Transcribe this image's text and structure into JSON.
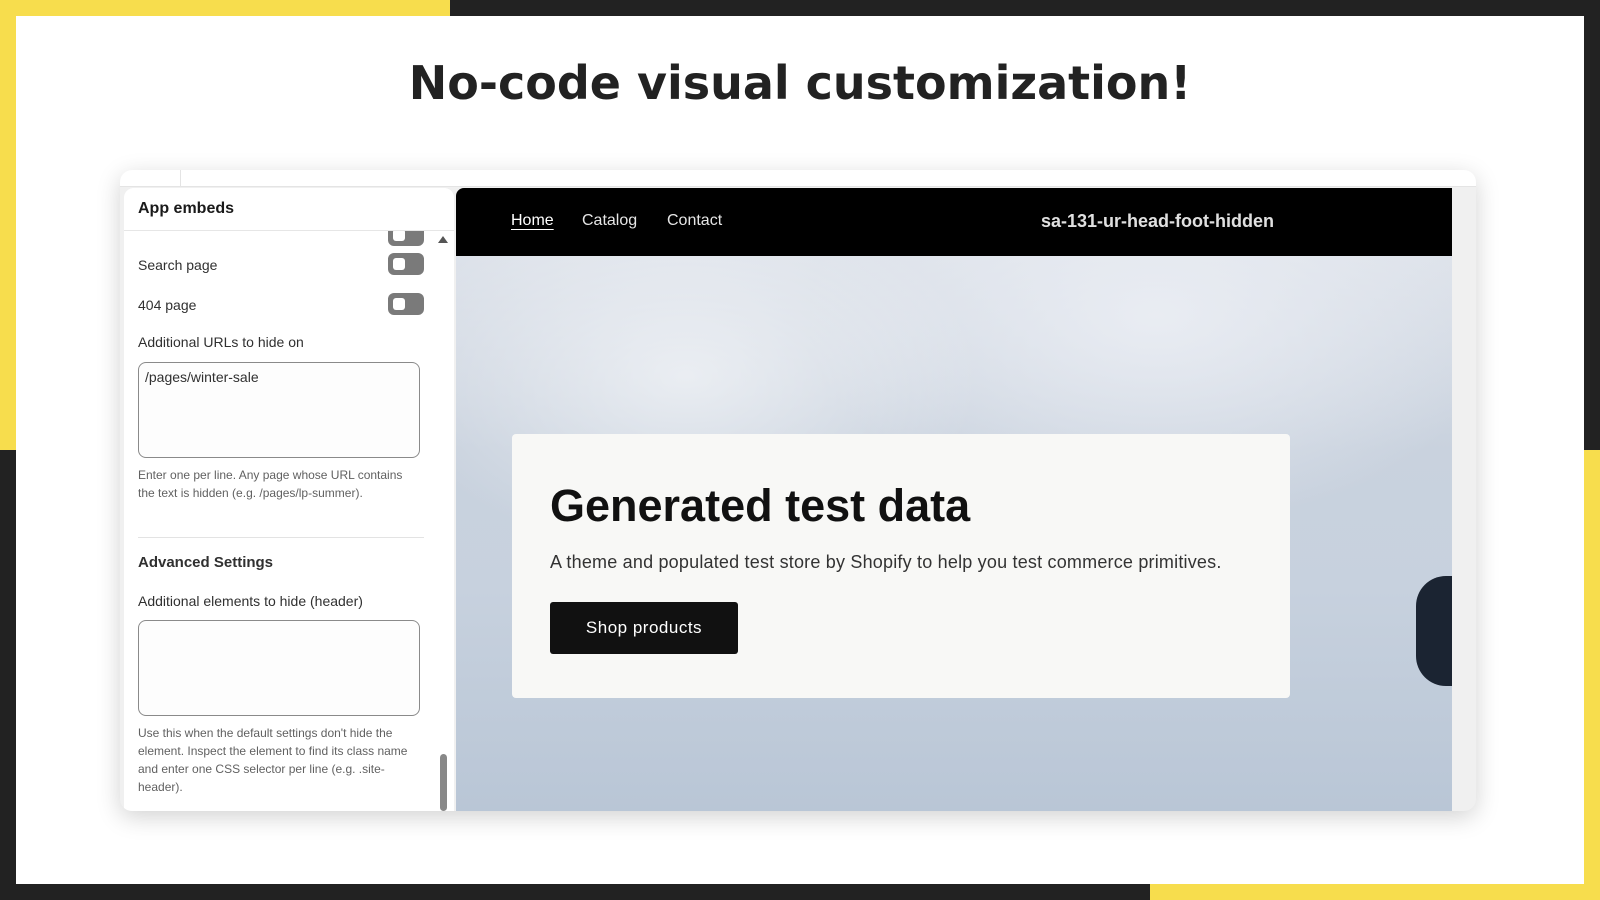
{
  "page": {
    "heading": "No-code visual customization!"
  },
  "sidebar": {
    "title": "App embeds",
    "toggles": [
      {
        "label": "Search page",
        "on": false
      },
      {
        "label": "404 page",
        "on": false
      }
    ],
    "urls_label": "Additional URLs to hide on",
    "urls_value": "/pages/winter-sale",
    "urls_help": "Enter one per line. Any page whose URL contains the text is hidden (e.g. /pages/lp-summer).",
    "advanced_title": "Advanced Settings",
    "header_elements_label": "Additional elements to hide (header)",
    "header_elements_value": "",
    "header_elements_help": "Use this when the default settings don't hide the element. Inspect the element to find its class name and enter one CSS selector per line (e.g. .site-header)."
  },
  "store": {
    "nav": [
      {
        "label": "Home",
        "active": true
      },
      {
        "label": "Catalog",
        "active": false
      },
      {
        "label": "Contact",
        "active": false
      }
    ],
    "store_name": "sa-131-ur-head-foot-hidden",
    "hero": {
      "title": "Generated test data",
      "subtitle": "A theme and populated test store by Shopify to help you test commerce primitives.",
      "button": "Shop products"
    }
  },
  "colors": {
    "accent_yellow": "#f7dd4d",
    "frame_dark": "#222222",
    "nav_bg": "#000000",
    "button_bg": "#111111"
  }
}
